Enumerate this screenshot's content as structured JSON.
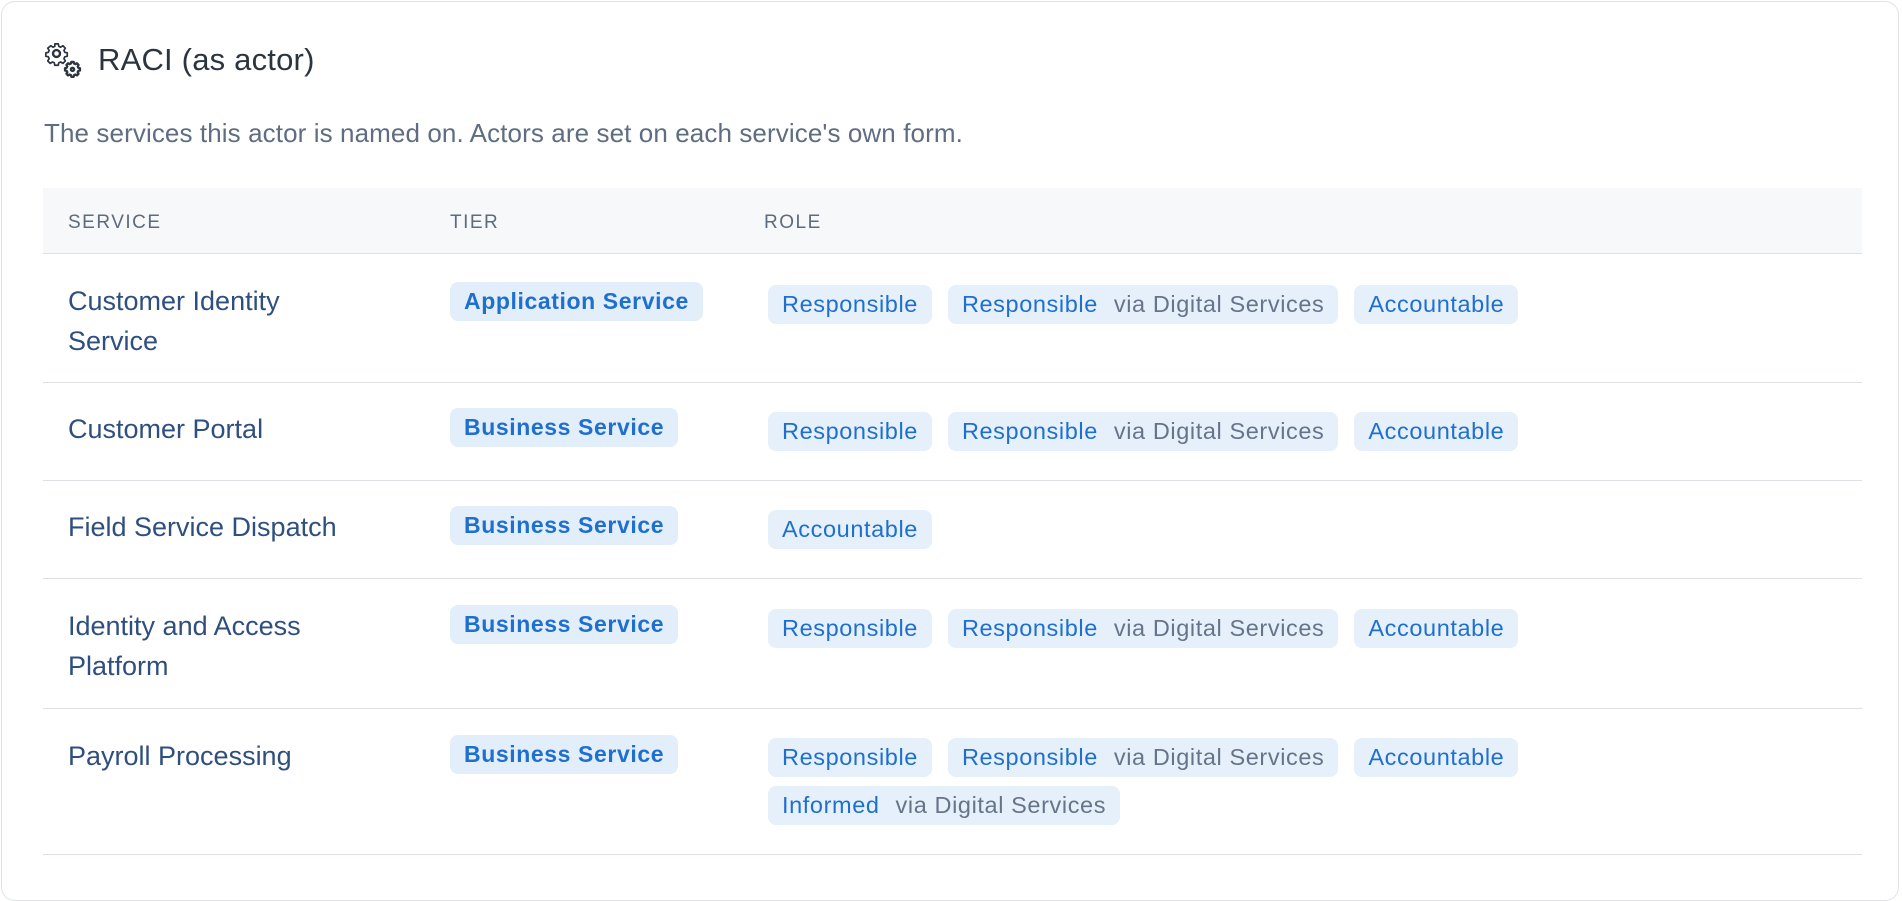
{
  "panel": {
    "title": "RACI (as actor)",
    "icon": "gear-icon",
    "description": "The services this actor is named on. Actors are set on each service's own form."
  },
  "table": {
    "headers": {
      "service": "SERVICE",
      "tier": "TIER",
      "role": "ROLE"
    },
    "rows": [
      {
        "service": "Customer Identity Service",
        "tier": "Application Service",
        "roles": [
          {
            "name": "Responsible",
            "via": ""
          },
          {
            "name": "Responsible",
            "via": "via Digital Services"
          },
          {
            "name": "Accountable",
            "via": ""
          }
        ]
      },
      {
        "service": "Customer Portal",
        "tier": "Business Service",
        "roles": [
          {
            "name": "Responsible",
            "via": ""
          },
          {
            "name": "Responsible",
            "via": "via Digital Services"
          },
          {
            "name": "Accountable",
            "via": ""
          }
        ]
      },
      {
        "service": "Field Service Dispatch",
        "tier": "Business Service",
        "roles": [
          {
            "name": "Accountable",
            "via": ""
          }
        ]
      },
      {
        "service": "Identity and Access Platform",
        "tier": "Business Service",
        "roles": [
          {
            "name": "Responsible",
            "via": ""
          },
          {
            "name": "Responsible",
            "via": "via Digital Services"
          },
          {
            "name": "Accountable",
            "via": ""
          }
        ]
      },
      {
        "service": "Payroll Processing",
        "tier": "Business Service",
        "roles": [
          {
            "name": "Responsible",
            "via": ""
          },
          {
            "name": "Responsible",
            "via": "via Digital Services"
          },
          {
            "name": "Accountable",
            "via": ""
          },
          {
            "name": "Informed",
            "via": "via Digital Services"
          }
        ]
      }
    ]
  },
  "colors": {
    "accent": "#1f6fcf",
    "pill_bg": "#e6f0fb",
    "service_text": "#2f4f7f",
    "muted_text": "#66748a"
  }
}
